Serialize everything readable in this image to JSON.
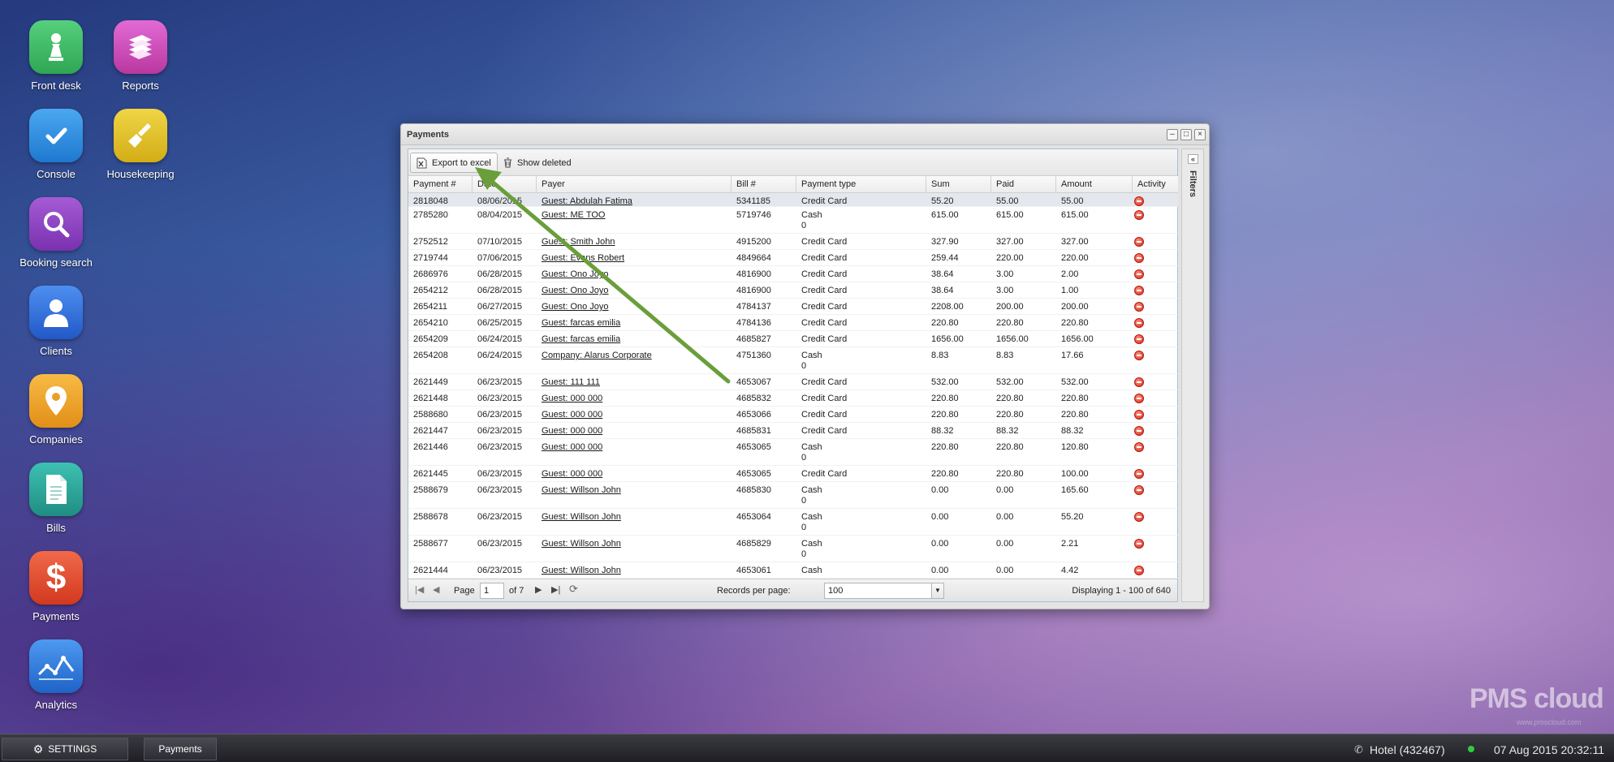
{
  "desktop": {
    "icons": [
      {
        "label": "Front desk",
        "icon": "pawn-icon",
        "color": "#3cb964"
      },
      {
        "label": "Reports",
        "icon": "books-icon",
        "color": "#d24fc4"
      },
      {
        "label": "Console",
        "icon": "checkmark-icon",
        "color": "#2f8fe0"
      },
      {
        "label": "Housekeeping",
        "icon": "broom-icon",
        "color": "#e2c12c"
      },
      {
        "label": "Booking search",
        "icon": "magnifier-icon",
        "color": "#9146c4"
      },
      {
        "label": "Clients",
        "icon": "person-icon",
        "color": "#2f74d8"
      },
      {
        "label": "Companies",
        "icon": "location-pin-icon",
        "color": "#f2a52a"
      },
      {
        "label": "Bills",
        "icon": "document-icon",
        "color": "#2da59a"
      },
      {
        "label": "Payments",
        "icon": "dollar-icon",
        "color": "#e54a33"
      },
      {
        "label": "Analytics",
        "icon": "line-chart-icon",
        "color": "#2f7fd6"
      }
    ]
  },
  "window": {
    "title": "Payments",
    "filters_label": "Filters",
    "toolbar": {
      "export_label": "Export to excel",
      "show_deleted_label": "Show deleted"
    },
    "columns": [
      "Payment #",
      "Date",
      "Payer",
      "Bill #",
      "Payment type",
      "Sum",
      "Paid",
      "Amount",
      "Activity"
    ],
    "rows": [
      {
        "payment": "2818048",
        "date": "08/06/2015",
        "payer": "Guest: Abdulah Fatima",
        "bill": "5341185",
        "type": "Credit Card",
        "type2": "",
        "sum": "55.20",
        "paid": "55.00",
        "amount": "55.00"
      },
      {
        "payment": "2785280",
        "date": "08/04/2015",
        "payer": "Guest: ME TOO",
        "bill": "5719746",
        "type": "Cash",
        "type2": "0",
        "sum": "615.00",
        "paid": "615.00",
        "amount": "615.00"
      },
      {
        "payment": "2752512",
        "date": "07/10/2015",
        "payer": "Guest: Smith John",
        "bill": "4915200",
        "type": "Credit Card",
        "type2": "",
        "sum": "327.90",
        "paid": "327.00",
        "amount": "327.00"
      },
      {
        "payment": "2719744",
        "date": "07/06/2015",
        "payer": "Guest: Evans Robert",
        "bill": "4849664",
        "type": "Credit Card",
        "type2": "",
        "sum": "259.44",
        "paid": "220.00",
        "amount": "220.00"
      },
      {
        "payment": "2686976",
        "date": "06/28/2015",
        "payer": "Guest: Ono Joyo",
        "bill": "4816900",
        "type": "Credit Card",
        "type2": "",
        "sum": "38.64",
        "paid": "3.00",
        "amount": "2.00"
      },
      {
        "payment": "2654212",
        "date": "06/28/2015",
        "payer": "Guest: Ono Joyo",
        "bill": "4816900",
        "type": "Credit Card",
        "type2": "",
        "sum": "38.64",
        "paid": "3.00",
        "amount": "1.00"
      },
      {
        "payment": "2654211",
        "date": "06/27/2015",
        "payer": "Guest: Ono Joyo",
        "bill": "4784137",
        "type": "Credit Card",
        "type2": "",
        "sum": "2208.00",
        "paid": "200.00",
        "amount": "200.00"
      },
      {
        "payment": "2654210",
        "date": "06/25/2015",
        "payer": "Guest: farcas emilia",
        "bill": "4784136",
        "type": "Credit Card",
        "type2": "",
        "sum": "220.80",
        "paid": "220.80",
        "amount": "220.80"
      },
      {
        "payment": "2654209",
        "date": "06/24/2015",
        "payer": "Guest: farcas emilia",
        "bill": "4685827",
        "type": "Credit Card",
        "type2": "",
        "sum": "1656.00",
        "paid": "1656.00",
        "amount": "1656.00"
      },
      {
        "payment": "2654208",
        "date": "06/24/2015",
        "payer": "Company: Alarus Corporate",
        "bill": "4751360",
        "type": "Cash",
        "type2": "0",
        "sum": "8.83",
        "paid": "8.83",
        "amount": "17.66"
      },
      {
        "payment": "2621449",
        "date": "06/23/2015",
        "payer": "Guest: 111 111",
        "bill": "4653067",
        "type": "Credit Card",
        "type2": "",
        "sum": "532.00",
        "paid": "532.00",
        "amount": "532.00"
      },
      {
        "payment": "2621448",
        "date": "06/23/2015",
        "payer": "Guest: 000 000",
        "bill": "4685832",
        "type": "Credit Card",
        "type2": "",
        "sum": "220.80",
        "paid": "220.80",
        "amount": "220.80"
      },
      {
        "payment": "2588680",
        "date": "06/23/2015",
        "payer": "Guest: 000 000",
        "bill": "4653066",
        "type": "Credit Card",
        "type2": "",
        "sum": "220.80",
        "paid": "220.80",
        "amount": "220.80"
      },
      {
        "payment": "2621447",
        "date": "06/23/2015",
        "payer": "Guest: 000 000",
        "bill": "4685831",
        "type": "Credit Card",
        "type2": "",
        "sum": "88.32",
        "paid": "88.32",
        "amount": "88.32"
      },
      {
        "payment": "2621446",
        "date": "06/23/2015",
        "payer": "Guest: 000 000",
        "bill": "4653065",
        "type": "Cash",
        "type2": "0",
        "sum": "220.80",
        "paid": "220.80",
        "amount": "120.80"
      },
      {
        "payment": "2621445",
        "date": "06/23/2015",
        "payer": "Guest: 000 000",
        "bill": "4653065",
        "type": "Credit Card",
        "type2": "",
        "sum": "220.80",
        "paid": "220.80",
        "amount": "100.00"
      },
      {
        "payment": "2588679",
        "date": "06/23/2015",
        "payer": "Guest: Willson John",
        "bill": "4685830",
        "type": "Cash",
        "type2": "0",
        "sum": "0.00",
        "paid": "0.00",
        "amount": "165.60"
      },
      {
        "payment": "2588678",
        "date": "06/23/2015",
        "payer": "Guest: Willson John",
        "bill": "4653064",
        "type": "Cash",
        "type2": "0",
        "sum": "0.00",
        "paid": "0.00",
        "amount": "55.20"
      },
      {
        "payment": "2588677",
        "date": "06/23/2015",
        "payer": "Guest: Willson John",
        "bill": "4685829",
        "type": "Cash",
        "type2": "0",
        "sum": "0.00",
        "paid": "0.00",
        "amount": "2.21"
      },
      {
        "payment": "2621444",
        "date": "06/23/2015",
        "payer": "Guest: Willson John",
        "bill": "4653061",
        "type": "Cash",
        "type2": "",
        "sum": "0.00",
        "paid": "0.00",
        "amount": "4.42"
      }
    ],
    "pager": {
      "page_label": "Page",
      "page_value": "1",
      "of_label": "of 7",
      "records_label": "Records per page:",
      "records_value": "100",
      "display_text": "Displaying 1 - 100 of 640"
    }
  },
  "taskbar": {
    "settings_label": "SETTINGS",
    "payments_label": "Payments",
    "hotel_label": "Hotel (432467)",
    "datetime": "07 Aug 2015 20:32:11",
    "status_color": "#2ecc40"
  },
  "watermark": {
    "brand": "PMS cloud",
    "url": "www.pmscloud.com"
  },
  "annotation_color": "#6a9e3a"
}
